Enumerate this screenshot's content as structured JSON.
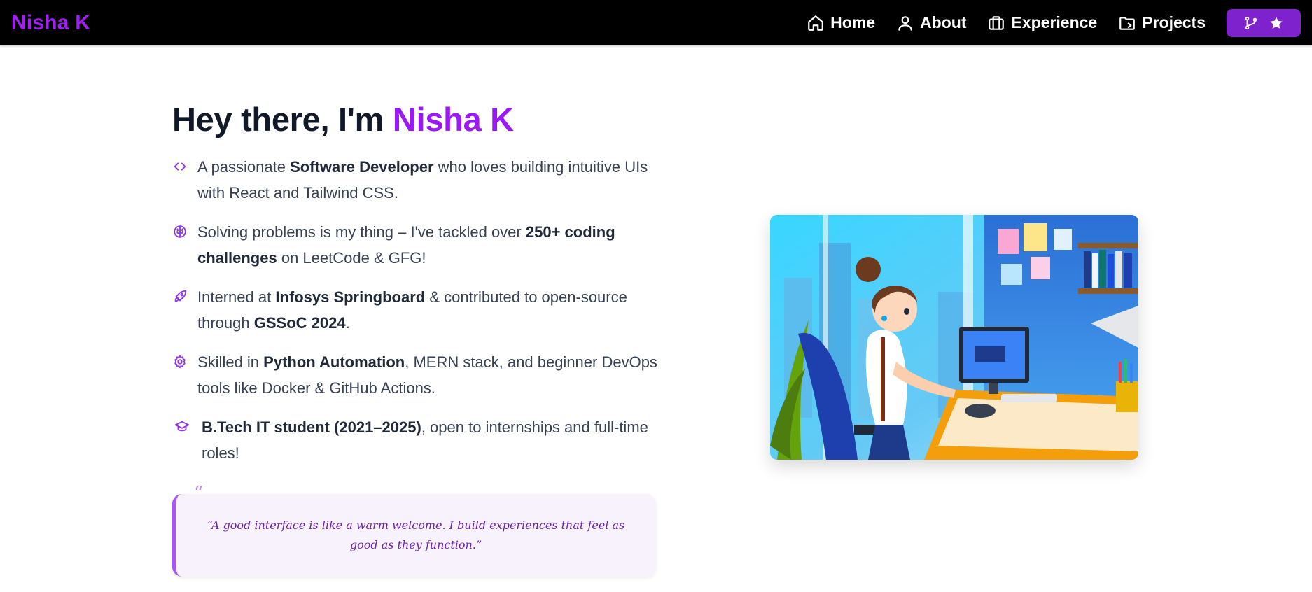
{
  "nav": {
    "brand": "Nisha K",
    "links": [
      {
        "label": "Home",
        "icon": "home-icon"
      },
      {
        "label": "About",
        "icon": "user-icon"
      },
      {
        "label": "Experience",
        "icon": "briefcase-icon"
      },
      {
        "label": "Projects",
        "icon": "folder-icon"
      }
    ],
    "action_icons": [
      "git-fork-icon",
      "star-icon"
    ]
  },
  "hero": {
    "greeting": "Hey there, I'm ",
    "name": "Nisha K",
    "points": [
      {
        "icon": "code-icon",
        "parts": [
          "A passionate ",
          "Software Developer",
          " who loves building intuitive UIs with React and Tailwind CSS."
        ]
      },
      {
        "icon": "brain-icon",
        "parts": [
          "Solving problems is my thing – I've tackled over ",
          "250+ coding challenges",
          " on LeetCode & GFG!"
        ]
      },
      {
        "icon": "rocket-icon",
        "parts": [
          "Interned at ",
          "Infosys Springboard",
          " & contributed to open-source through ",
          "GSSoC 2024",
          "."
        ]
      },
      {
        "icon": "settings-icon",
        "parts": [
          "Skilled in ",
          "Python Automation",
          ", MERN stack, and beginner DevOps tools like Docker & GitHub Actions."
        ]
      },
      {
        "icon": "graduation-cap-icon",
        "parts": [
          "",
          "B.Tech IT student (2021–2025)",
          ", open to internships and full-time roles!"
        ]
      }
    ],
    "quote_mark": "“",
    "quote": "“A good interface is like a warm welcome. I build experiences that feel as good as they function.”"
  },
  "colors": {
    "accent": "#9b19f5",
    "nav_bg": "#000000",
    "button_bg": "#7e22ce",
    "quote_bg": "#f8f2fd"
  }
}
